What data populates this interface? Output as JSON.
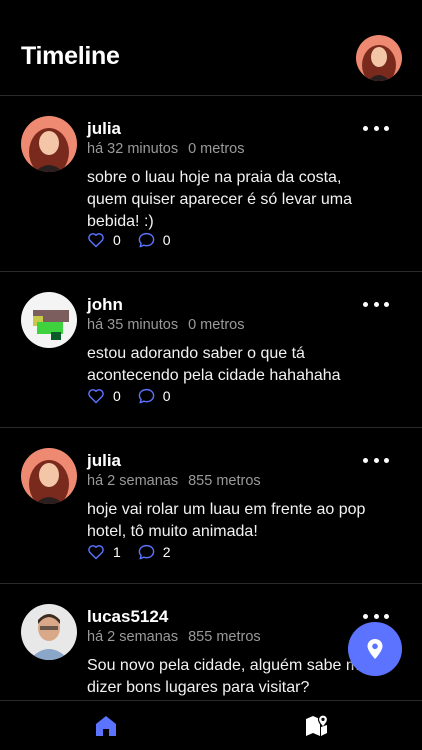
{
  "header": {
    "title": "Timeline",
    "avatar_icon": "user-avatar-icon"
  },
  "posts": [
    {
      "author": "julia",
      "time": "há 32 minutos",
      "distance": "0 metros",
      "text": "sobre o luau hoje na praia da costa, quem quiser aparecer é só levar uma bebida! :)",
      "likes": "0",
      "comments": "0",
      "avatar": "julia"
    },
    {
      "author": "john",
      "time": "há 35 minutos",
      "distance": "0 metros",
      "text": "estou adorando saber o que tá acontecendo pela cidade hahahaha",
      "likes": "0",
      "comments": "0",
      "avatar": "john"
    },
    {
      "author": "julia",
      "time": "há 2 semanas",
      "distance": "855 metros",
      "text": "hoje vai rolar um luau em frente ao pop hotel, tô muito animada!",
      "likes": "1",
      "comments": "2",
      "avatar": "julia"
    },
    {
      "author": "lucas5124",
      "time": "há 2 semanas",
      "distance": "855 metros",
      "text": "Sou novo pela cidade, alguém sabe me dizer bons lugares para visitar?",
      "likes": "",
      "comments": "",
      "avatar": "lucas"
    }
  ],
  "fab": {
    "icon": "location-pin-icon"
  },
  "tabs": [
    {
      "icon": "home-icon",
      "active": true
    },
    {
      "icon": "map-icon",
      "active": false
    }
  ],
  "colors": {
    "accent": "#5b73ff",
    "background": "#000000",
    "muted": "#9a9a9a"
  }
}
